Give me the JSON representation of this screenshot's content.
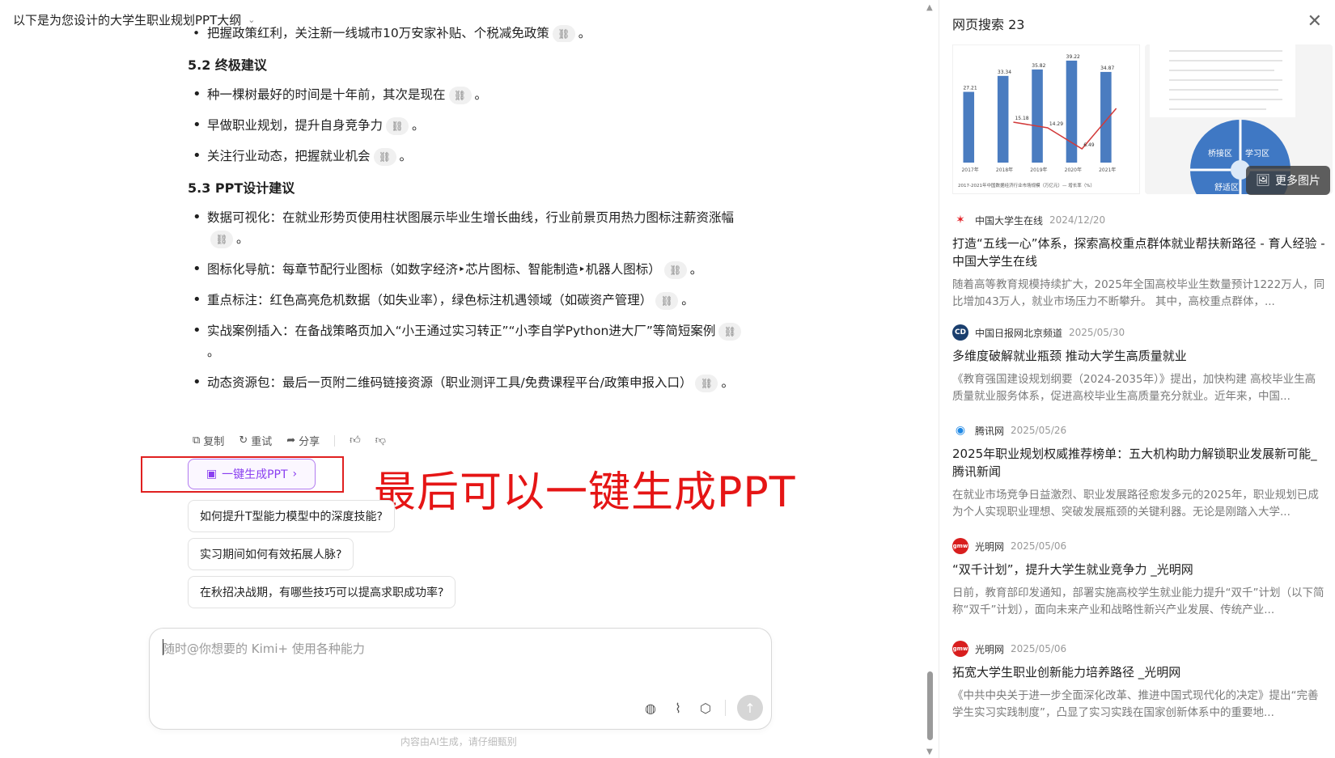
{
  "topbar": {
    "title": "以下是为您设计的大学生职业规划PPT大纲"
  },
  "content": {
    "cut_line": "把握政策红利，关注新一线城市10万安家补贴、个税减免政策",
    "sec52": "5.2 终极建议",
    "sec52_items": [
      "种一棵树最好的时间是十年前，其次是现在",
      "早做职业规划，提升自身竞争力",
      "关注行业动态，把握就业机会"
    ],
    "sec53": "5.3 PPT设计建议",
    "sec53_items": [
      "数据可视化：在就业形势页使用柱状图展示毕业生增长曲线，行业前景页用热力图标注薪资涨幅",
      "图标化导航：每章节配行业图标（如数字经济‣芯片图标、智能制造‣机器人图标）",
      "重点标注：红色高亮危机数据（如失业率），绿色标注机遇领域（如碳资产管理）",
      "实战案例插入：在备战策略页加入“小王通过实习转正”“小李自学Python进大厂”等简短案例",
      "动态资源包：最后一页附二维码链接资源（职业测评工具/免费课程平台/政策申报入口）"
    ]
  },
  "actions": {
    "copy": "复制",
    "retry": "重试",
    "share": "分享"
  },
  "ppt_button": "一键生成PPT",
  "annotation": "最后可以一键生成PPT",
  "suggestions": [
    "如何提升T型能力模型中的深度技能?",
    "实习期间如何有效拓展人脉?",
    "在秋招决战期，有哪些技巧可以提高求职成功率?"
  ],
  "input": {
    "placeholder": "随时@你想要的 Kimi+ 使用各种能力"
  },
  "disclaimer": "内容由AI生成，请仔细甄别",
  "panel": {
    "title": "网页搜索 23",
    "more_images": "更多图片",
    "mini_chart": {
      "years": [
        "2017年",
        "2018年",
        "2019年",
        "2020年",
        "2021年"
      ],
      "bars": [
        27.21,
        33.34,
        35.82,
        39.22,
        34.87
      ],
      "line_labels": [
        "15.18",
        "14.29",
        "6.49"
      ],
      "legend": "2017-2021年中国数据经济行业市场规模（万亿元）— 增长率（%）"
    },
    "mini_diagram_labels": [
      "桥接区",
      "学习区",
      "舒适区"
    ],
    "results": [
      {
        "source": "中国大学生在线",
        "date": "2024/12/20",
        "logo_color": "#e31e24",
        "logo_text": "✶",
        "title": "打造“五线一心”体系，探索高校重点群体就业帮扶新路径 - 育人经验 - 中国大学生在线",
        "snippet": "随着高等教育规模持续扩大，2025年全国高校毕业生数量预计1222万人，同比增加43万人，就业市场压力不断攀升。 其中，高校重点群体，..."
      },
      {
        "source": "中国日报网北京频道",
        "date": "2025/05/30",
        "logo_color": "#1a3f6e",
        "logo_text": "CD",
        "title": "多维度破解就业瓶颈 推动大学生高质量就业",
        "snippet": "《教育强国建设规划纲要（2024-2035年）》提出，加快构建 高校毕业生高质量就业服务体系，促进高校毕业生高质量充分就业。近年来，中国..."
      },
      {
        "source": "腾讯网",
        "date": "2025/05/26",
        "logo_color": "#1e88e5",
        "logo_text": "◉",
        "title": "2025年职业规划权威推荐榜单：五大机构助力解锁职业发展新可能_腾讯新闻",
        "snippet": "在就业市场竞争日益激烈、职业发展路径愈发多元的2025年，职业规划已成为个人实现职业理想、突破发展瓶颈的关键利器。无论是刚踏入大学..."
      },
      {
        "source": "光明网",
        "date": "2025/05/06",
        "logo_color": "#d81e1e",
        "logo_text": "gmw",
        "title": "“双千计划”，提升大学生就业竞争力 _光明网",
        "snippet": "日前，教育部印发通知，部署实施高校学生就业能力提升“双千”计划（以下简称“双千”计划），面向未来产业和战略性新兴产业发展、传统产业..."
      },
      {
        "source": "光明网",
        "date": "2025/05/06",
        "logo_color": "#d81e1e",
        "logo_text": "gmw",
        "title": "拓宽大学生职业创新能力培养路径 _光明网",
        "snippet": "《中共中央关于进一步全面深化改革、推进中国式现代化的决定》提出“完善学生实习实践制度”，凸显了实习实践在国家创新体系中的重要地..."
      }
    ]
  }
}
